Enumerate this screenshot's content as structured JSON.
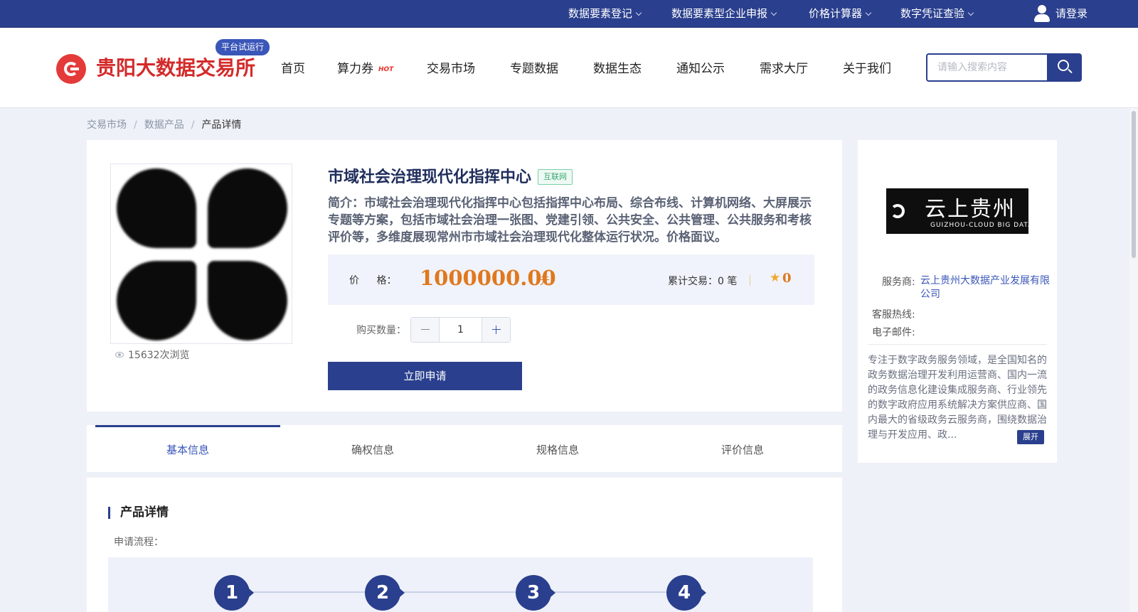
{
  "topbar": {
    "items": [
      {
        "label": "数据要素登记"
      },
      {
        "label": "数据要素型企业申报"
      },
      {
        "label": "价格计算器"
      },
      {
        "label": "数字凭证查验"
      }
    ],
    "login_label": "请登录"
  },
  "header": {
    "logo_text": "贵阳大数据交易所",
    "trial_badge": "平台试运行",
    "nav": [
      {
        "label": "首页"
      },
      {
        "label": "算力券"
      },
      {
        "label": "交易市场"
      },
      {
        "label": "专题数据"
      },
      {
        "label": "数据生态"
      },
      {
        "label": "通知公示"
      },
      {
        "label": "需求大厅"
      },
      {
        "label": "关于我们"
      }
    ],
    "hot_tag": "HOT",
    "search_placeholder": "请输入搜索内容"
  },
  "breadcrumb": [
    "交易市场",
    "数据产品",
    "产品详情"
  ],
  "product": {
    "title": "市域社会治理现代化指挥中心",
    "network_badge": "互联网",
    "description": "简介：市域社会治理现代化指挥中心包括指挥中心布局、综合布线、计算机网络、大屏展示专题等方案，包括市域社会治理一张图、党建引领、公共安全、公共管理、公共服务和考核评价等，多维度展现常州市市域社会治理现代化整体运行状况。价格面议。",
    "views": "15632次浏览",
    "price_label": "价 格：",
    "price": "1000000.00",
    "price_unit": "元",
    "trade_count": "累计交易：0 笔",
    "rating": "0",
    "qty_label": "购买数量：",
    "qty": "1",
    "apply_label": "立即申请"
  },
  "tabs": [
    {
      "label": "基本信息",
      "active": true
    },
    {
      "label": "确权信息",
      "active": false
    },
    {
      "label": "规格信息",
      "active": false
    },
    {
      "label": "评价信息",
      "active": false
    }
  ],
  "detail": {
    "section_title": "产品详情",
    "flow_label": "申请流程：",
    "steps": [
      "1",
      "2",
      "3",
      "4"
    ]
  },
  "merchant": {
    "logo_cn": "云上贵州",
    "logo_en": "GUIZHOU-CLOUD BIG DATA",
    "provider_label": "服务商:",
    "provider_name": "云上贵州大数据产业发展有限公司",
    "hotline_label": "客服热线:",
    "email_label": "电子邮件:",
    "intro": "专注于数字政务服务领域，是全国知名的政务数据治理开发利用运营商、国内一流的政务信息化建设集成服务商、行业领先的数字政府应用系统解决方案供应商、国内最大的省级政务云服务商，围绕数据治理与开发应用、政...",
    "expand_label": "展开"
  },
  "colors": {
    "brand_blue": "#2a3f8d",
    "logo_red": "#d42a2a",
    "price_orange": "#e0781d"
  }
}
